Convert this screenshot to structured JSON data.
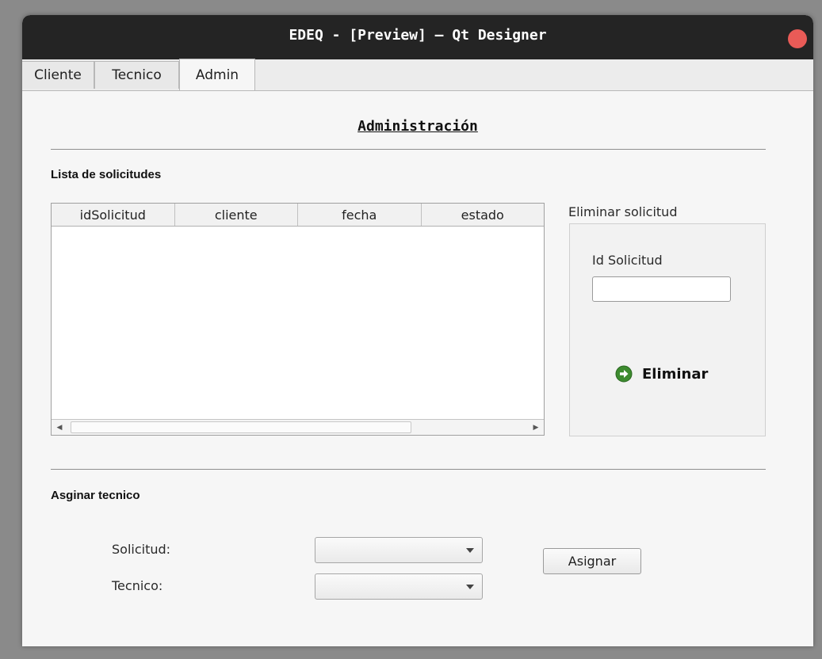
{
  "window": {
    "title": "EDEQ - [Preview] — Qt Designer"
  },
  "tabs": [
    {
      "label": "Cliente"
    },
    {
      "label": "Tecnico"
    },
    {
      "label": "Admin",
      "active": true
    }
  ],
  "admin": {
    "heading": "Administración",
    "requests_label": "Lista de solicitudes",
    "table": {
      "columns": [
        "idSolicitud",
        "cliente",
        "fecha",
        "estado"
      ],
      "rows": []
    },
    "delete_group": {
      "title": "Eliminar solicitud",
      "id_label": "Id Solicitud",
      "id_value": "",
      "button_label": "Eliminar",
      "button_icon": "go-arrow-icon"
    },
    "assign": {
      "title": "Asginar tecnico",
      "request_label": "Solicitud:",
      "request_value": "",
      "tech_label": "Tecnico:",
      "tech_value": "",
      "button_label": "Asignar"
    }
  },
  "colors": {
    "titlebar": "#242424",
    "close_button": "#e95b57",
    "icon_green": "#3d8b2f"
  }
}
